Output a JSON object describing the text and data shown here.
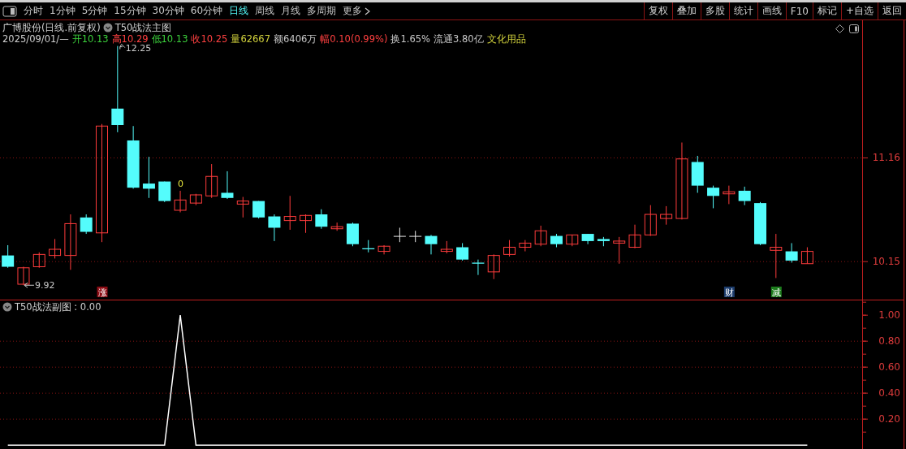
{
  "toolbar": {
    "tabs": [
      {
        "label": "分时",
        "selected": false
      },
      {
        "label": "1分钟",
        "selected": false
      },
      {
        "label": "5分钟",
        "selected": false
      },
      {
        "label": "15分钟",
        "selected": false
      },
      {
        "label": "30分钟",
        "selected": false
      },
      {
        "label": "60分钟",
        "selected": false
      },
      {
        "label": "日线",
        "selected": true
      },
      {
        "label": "周线",
        "selected": false
      },
      {
        "label": "月线",
        "selected": false
      },
      {
        "label": "多周期",
        "selected": false
      },
      {
        "label": "更多",
        "selected": false,
        "kind": "more"
      }
    ],
    "buttons": [
      "复权",
      "叠加",
      "多股",
      "统计",
      "画线",
      "F10",
      "标记",
      "+自选",
      "返回"
    ]
  },
  "main_chart": {
    "title": "广博股份(日线.前复权)",
    "indicator": "T50战法主图",
    "date": "2025/09/01/—",
    "quote": [
      {
        "text": "开10.13",
        "color": "#3cd23c"
      },
      {
        "text": "高10.29",
        "color": "#ff4040"
      },
      {
        "text": "低10.13",
        "color": "#3cd23c"
      },
      {
        "text": "收10.25",
        "color": "#ff4040"
      },
      {
        "text": "量62667",
        "color": "#d2d23c"
      },
      {
        "text": "额6406万",
        "color": "#c8c8c8"
      },
      {
        "text": "幅0.10(0.99%)",
        "color": "#ff4040"
      },
      {
        "text": "换1.65%",
        "color": "#c8c8c8"
      },
      {
        "text": "流通3.80亿",
        "color": "#c8c8c8"
      },
      {
        "text": "文化用品",
        "color": "#d2d23c"
      }
    ],
    "high_label": "12.25",
    "low_label": "9.92",
    "signal_label": "0",
    "tags": [
      {
        "text": "涨",
        "color": "#8c0c14"
      },
      {
        "text": "财",
        "color": "#1c3c6c"
      },
      {
        "text": "减",
        "color": "#1c7c1c"
      }
    ],
    "chart_data": {
      "type": "candlestick",
      "ylim": [
        9.78,
        12.5
      ],
      "grid": true,
      "yticks": [
        {
          "value": 11.16,
          "label": "11.16"
        },
        {
          "value": 10.15,
          "label": "10.15"
        }
      ],
      "categories": [
        null,
        null,
        null,
        null,
        null,
        null,
        null,
        null,
        null,
        null,
        null,
        null,
        null,
        null,
        null,
        null,
        null,
        null,
        null,
        null,
        null,
        null,
        null,
        null,
        null,
        null,
        null,
        null,
        null,
        null,
        null,
        null,
        null,
        null,
        null,
        null,
        null,
        null,
        null,
        null,
        null,
        null,
        null,
        null,
        null,
        null,
        null,
        null,
        null,
        null,
        null,
        null,
        null,
        null,
        null
      ],
      "ohlc": [
        [
          10.21,
          10.31,
          10.09,
          10.1
        ],
        [
          9.93,
          10.1,
          9.92,
          10.09
        ],
        [
          10.1,
          10.24,
          10.09,
          10.22
        ],
        [
          10.21,
          10.37,
          10.18,
          10.27
        ],
        [
          10.21,
          10.61,
          10.07,
          10.52
        ],
        [
          10.58,
          10.61,
          10.42,
          10.44
        ],
        [
          10.43,
          11.49,
          10.34,
          11.47
        ],
        [
          11.64,
          12.25,
          11.41,
          11.48
        ],
        [
          11.33,
          11.47,
          10.86,
          10.87
        ],
        [
          10.91,
          11.17,
          10.77,
          10.86
        ],
        [
          10.93,
          10.93,
          10.73,
          10.74
        ],
        [
          10.65,
          10.84,
          10.63,
          10.75
        ],
        [
          10.72,
          10.81,
          10.7,
          10.8
        ],
        [
          10.79,
          11.1,
          10.77,
          10.98
        ],
        [
          10.82,
          11.03,
          10.76,
          10.77
        ],
        [
          10.71,
          10.78,
          10.58,
          10.74
        ],
        [
          10.74,
          10.74,
          10.57,
          10.58
        ],
        [
          10.59,
          10.61,
          10.35,
          10.48
        ],
        [
          10.55,
          10.79,
          10.46,
          10.59
        ],
        [
          10.55,
          10.61,
          10.43,
          10.6
        ],
        [
          10.61,
          10.66,
          10.47,
          10.49
        ],
        [
          10.47,
          10.53,
          10.45,
          10.49
        ],
        [
          10.52,
          10.53,
          10.3,
          10.32
        ],
        [
          10.28,
          10.36,
          10.24,
          10.27
        ],
        [
          10.25,
          10.31,
          10.22,
          10.3
        ],
        [
          10.4,
          10.48,
          10.34,
          10.4
        ],
        [
          10.4,
          10.45,
          10.34,
          10.4
        ],
        [
          10.4,
          10.41,
          10.22,
          10.32
        ],
        [
          10.25,
          10.35,
          10.23,
          10.27
        ],
        [
          10.29,
          10.33,
          10.16,
          10.17
        ],
        [
          10.14,
          10.17,
          10.02,
          10.13
        ],
        [
          10.05,
          10.22,
          9.98,
          10.21
        ],
        [
          10.22,
          10.36,
          10.2,
          10.29
        ],
        [
          10.29,
          10.36,
          10.25,
          10.33
        ],
        [
          10.32,
          10.5,
          10.3,
          10.45
        ],
        [
          10.4,
          10.42,
          10.29,
          10.32
        ],
        [
          10.32,
          10.41,
          10.3,
          10.41
        ],
        [
          10.42,
          10.42,
          10.32,
          10.35
        ],
        [
          10.37,
          10.39,
          10.3,
          10.35
        ],
        [
          10.33,
          10.39,
          10.13,
          10.35
        ],
        [
          10.29,
          10.51,
          10.28,
          10.41
        ],
        [
          10.41,
          10.7,
          10.4,
          10.61
        ],
        [
          10.57,
          10.69,
          10.51,
          10.61
        ],
        [
          10.57,
          11.31,
          10.56,
          11.15
        ],
        [
          11.12,
          11.18,
          10.82,
          10.89
        ],
        [
          10.87,
          10.89,
          10.67,
          10.79
        ],
        [
          10.81,
          10.89,
          10.71,
          10.83
        ],
        [
          10.84,
          10.88,
          10.7,
          10.74
        ],
        [
          10.72,
          10.73,
          10.31,
          10.32
        ],
        [
          10.26,
          10.42,
          9.99,
          10.29
        ],
        [
          10.25,
          10.33,
          10.14,
          10.16
        ],
        [
          10.13,
          10.29,
          10.13,
          10.25
        ],
        null,
        null,
        null
      ]
    }
  },
  "sub_chart": {
    "title": "T50战法副图 : 0.00",
    "chart_data": {
      "type": "line",
      "ylim": [
        -0.03,
        1.12
      ],
      "grid": true,
      "yticks": [
        {
          "value": 1,
          "label": "1.00"
        },
        {
          "value": 0.8,
          "label": "0.80"
        },
        {
          "value": 0.6,
          "label": "0.60"
        },
        {
          "value": 0.4,
          "label": "0.40"
        },
        {
          "value": 0.2,
          "label": "0.20"
        }
      ],
      "series": [
        {
          "color": "#ffffff",
          "values": [
            0,
            0,
            0,
            0,
            0,
            0,
            0,
            0,
            0,
            0,
            0,
            1,
            0,
            0,
            0,
            0,
            0,
            0,
            0,
            0,
            0,
            0,
            0,
            0,
            0,
            0,
            0,
            0,
            0,
            0,
            0,
            0,
            0,
            0,
            0,
            0,
            0,
            0,
            0,
            0,
            0,
            0,
            0,
            0,
            0,
            0,
            0,
            0,
            0,
            0,
            0,
            0
          ]
        }
      ]
    }
  }
}
